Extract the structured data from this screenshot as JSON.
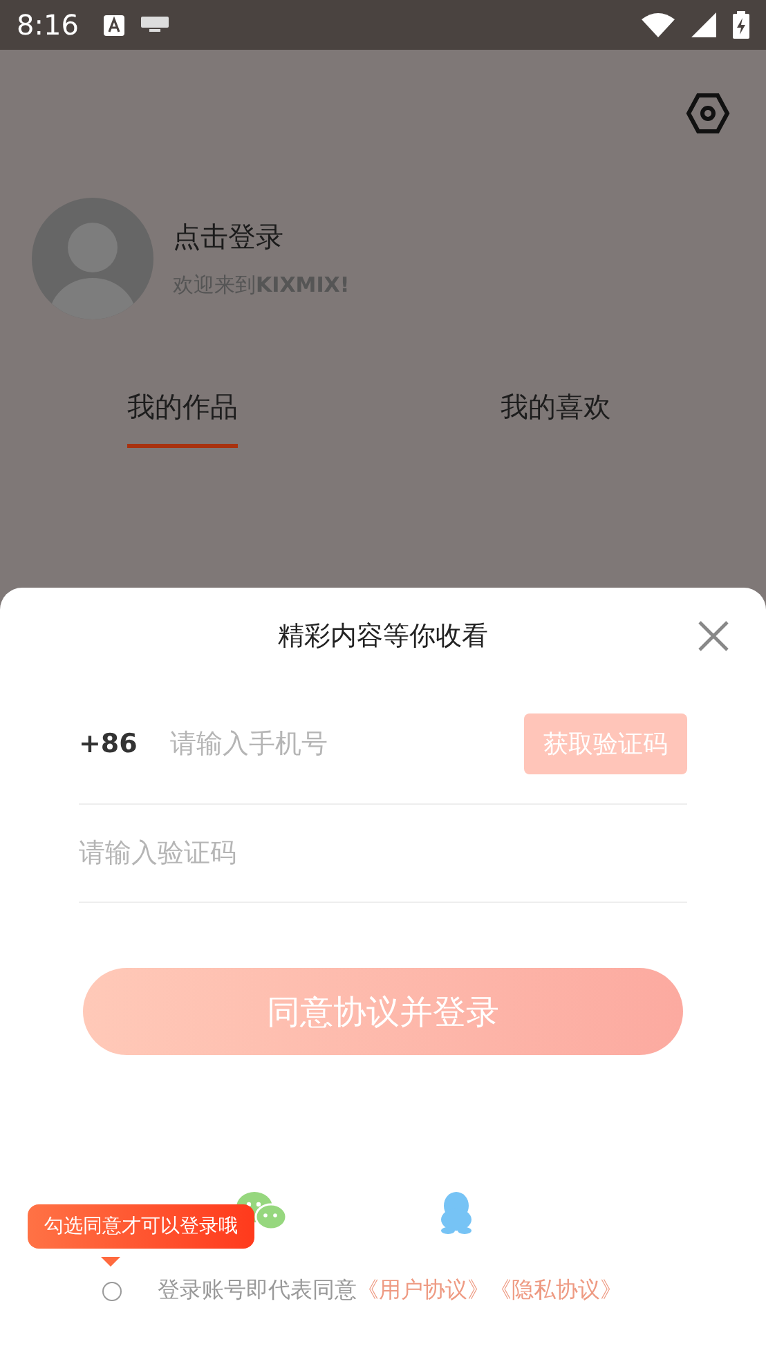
{
  "status_bar": {
    "time": "8:16"
  },
  "profile": {
    "title": "点击登录",
    "subtitle": "欢迎来到**KIXMIX!**"
  },
  "tabs": [
    {
      "label": "我的作品",
      "selected": true
    },
    {
      "label": "我的喜欢",
      "selected": false
    }
  ],
  "login_sheet": {
    "title": "精彩内容等你收看",
    "country_code": "+86",
    "phone_placeholder": "请输入手机号",
    "code_button": "获取验证码",
    "code_placeholder": "请输入验证码",
    "login_button": "同意协议并登录",
    "agreement": {
      "checked": false,
      "text": "登录账号即代表同意",
      "links": [
        "《用户协议》",
        "《隐私协议》"
      ],
      "tooltip": "勾选同意才可以登录哦"
    }
  }
}
